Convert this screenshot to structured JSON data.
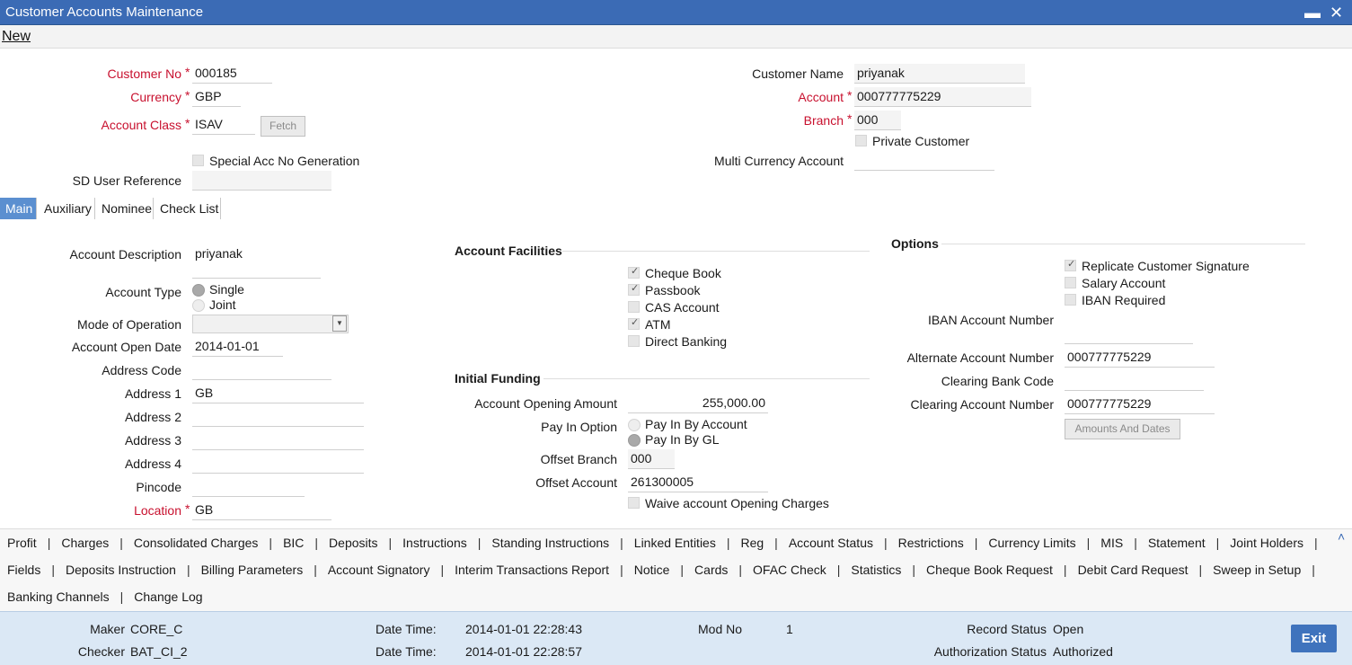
{
  "window": {
    "title": "Customer Accounts Maintenance",
    "minimize": "▬",
    "close": "✕"
  },
  "menu": {
    "new_label": "New"
  },
  "header": {
    "customer_no": {
      "label": "Customer No",
      "value": "000185"
    },
    "currency": {
      "label": "Currency",
      "value": "GBP"
    },
    "account_class": {
      "label": "Account Class",
      "value": "ISAV"
    },
    "fetch_label": "Fetch",
    "special_acc_label": "Special Acc No Generation",
    "sd_user_ref": {
      "label": "SD User Reference",
      "value": ""
    },
    "customer_name": {
      "label": "Customer Name",
      "value": "priyanak"
    },
    "account": {
      "label": "Account",
      "value": "000777775229"
    },
    "branch": {
      "label": "Branch",
      "value": "000"
    },
    "private_customer_label": "Private Customer",
    "multi_currency": {
      "label": "Multi Currency Account",
      "value": ""
    },
    "required_marker": "*"
  },
  "tabs": [
    "Main",
    "Auxiliary",
    "Nominee",
    "Check List"
  ],
  "main": {
    "account_description": {
      "label": "Account Description",
      "value": "priyanak"
    },
    "account_type": {
      "label": "Account Type",
      "options": [
        "Single",
        "Joint"
      ],
      "selected": "Single"
    },
    "mode_of_operation": {
      "label": "Mode of Operation",
      "value": ""
    },
    "account_open_date": {
      "label": "Account Open Date",
      "value": "2014-01-01"
    },
    "address_code": {
      "label": "Address Code",
      "value": ""
    },
    "address1": {
      "label": "Address 1",
      "value": "GB"
    },
    "address2": {
      "label": "Address 2",
      "value": ""
    },
    "address3": {
      "label": "Address 3",
      "value": ""
    },
    "address4": {
      "label": "Address 4",
      "value": ""
    },
    "pincode": {
      "label": "Pincode",
      "value": ""
    },
    "location": {
      "label": "Location",
      "value": "GB"
    }
  },
  "facilities": {
    "title": "Account Facilities",
    "items": [
      {
        "label": "Cheque Book",
        "checked": true
      },
      {
        "label": "Passbook",
        "checked": true
      },
      {
        "label": "CAS Account",
        "checked": false
      },
      {
        "label": "ATM",
        "checked": true
      },
      {
        "label": "Direct Banking",
        "checked": false
      }
    ]
  },
  "funding": {
    "title": "Initial Funding",
    "opening_amount": {
      "label": "Account Opening Amount",
      "value": "255,000.00"
    },
    "pay_in_option": {
      "label": "Pay In Option",
      "options": [
        "Pay In By Account",
        "Pay In By GL"
      ],
      "selected": "Pay In By GL"
    },
    "offset_branch": {
      "label": "Offset Branch",
      "value": "000"
    },
    "offset_account": {
      "label": "Offset Account",
      "value": "261300005"
    },
    "waive_label": "Waive account Opening Charges"
  },
  "options": {
    "title": "Options",
    "items": [
      {
        "label": "Replicate Customer Signature",
        "checked": true
      },
      {
        "label": "Salary Account",
        "checked": false
      },
      {
        "label": "IBAN Required",
        "checked": false
      }
    ],
    "iban_account_number": {
      "label": "IBAN Account Number",
      "value": ""
    },
    "alternate_account_number": {
      "label": "Alternate Account Number",
      "value": "000777775229"
    },
    "clearing_bank_code": {
      "label": "Clearing Bank Code",
      "value": ""
    },
    "clearing_account_number": {
      "label": "Clearing Account Number",
      "value": "000777775229"
    },
    "amounts_dates_label": "Amounts And Dates"
  },
  "links": {
    "row1": [
      "Profit",
      "Charges",
      "Consolidated Charges",
      "BIC",
      "Deposits",
      "Instructions",
      "Standing Instructions",
      "Linked Entities",
      "Reg",
      "Account Status",
      "Restrictions",
      "Currency Limits",
      "MIS",
      "Statement",
      "Joint Holders"
    ],
    "row2": [
      "Fields",
      "Deposits Instruction",
      "Billing Parameters",
      "Account Signatory",
      "Interim Transactions Report",
      "Notice",
      "Cards",
      "OFAC Check",
      "Statistics",
      "Cheque Book Request",
      "Debit Card Request",
      "Sweep in Setup"
    ],
    "row3": [
      "Banking Channels",
      "Change Log"
    ],
    "separator": "|",
    "collapse_icon": "˄"
  },
  "footer": {
    "maker_label": "Maker",
    "maker": "CORE_C",
    "checker_label": "Checker",
    "checker": "BAT_CI_2",
    "datetime_label": "Date Time:",
    "maker_datetime": "2014-01-01 22:28:43",
    "checker_datetime": "2014-01-01 22:28:57",
    "modno_label": "Mod No",
    "modno": "1",
    "record_status_label": "Record Status",
    "record_status": "Open",
    "auth_status_label": "Authorization Status",
    "auth_status": "Authorized",
    "exit_label": "Exit"
  },
  "colors": {
    "titlebar": "#3b6bb5",
    "required": "#c8102e",
    "tab_active": "#5b8fd0",
    "footer": "#dbe8f5",
    "exit": "#3f73bd"
  }
}
